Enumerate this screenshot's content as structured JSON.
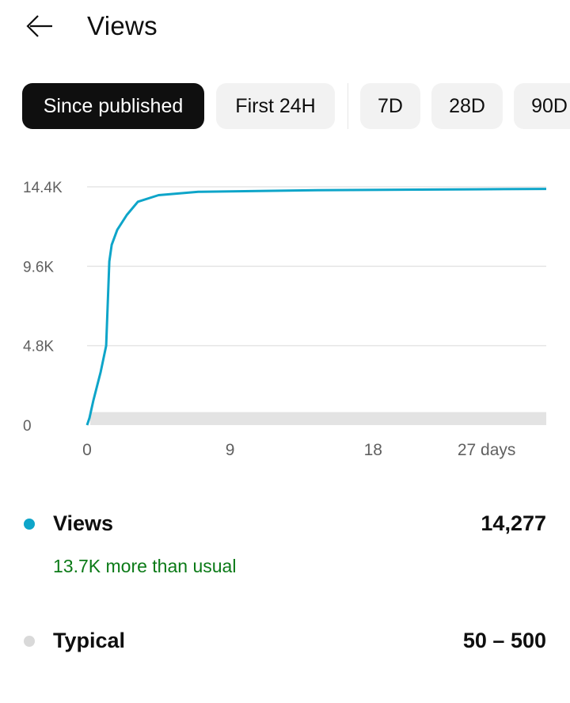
{
  "header": {
    "title": "Views",
    "back_icon": "arrow-left-icon"
  },
  "filters": {
    "chips": [
      {
        "label": "Since published",
        "active": true
      },
      {
        "label": "First 24H",
        "active": false
      },
      {
        "label": "7D",
        "active": false
      },
      {
        "label": "28D",
        "active": false
      },
      {
        "label": "90D",
        "active": false
      }
    ]
  },
  "colors": {
    "views": "#0ea5c9",
    "typical": "#d9d9d9",
    "positive": "#0b7a17",
    "active_chip": "#0f0f0f"
  },
  "chart_data": {
    "type": "line",
    "title": "",
    "xlabel": "",
    "ylabel": "",
    "x_ticks": [
      {
        "value": 0,
        "label": "0"
      },
      {
        "value": 9,
        "label": "9"
      },
      {
        "value": 18,
        "label": "18"
      },
      {
        "value": 27,
        "label": "27 days"
      }
    ],
    "y_ticks": [
      {
        "value": 0,
        "label": "0"
      },
      {
        "value": 4800,
        "label": "4.8K"
      },
      {
        "value": 9600,
        "label": "9.6K"
      },
      {
        "value": 14400,
        "label": "14.4K"
      }
    ],
    "xlim": [
      0,
      28.9
    ],
    "ylim": [
      0,
      14400
    ],
    "grid": true,
    "series": [
      {
        "name": "Views",
        "x": [
          0,
          0.15,
          0.4,
          0.85,
          1.2,
          1.4,
          1.55,
          1.9,
          2.5,
          3.2,
          4.5,
          7,
          14.5,
          24.5,
          28.9
        ],
        "values": [
          0,
          430,
          1500,
          3200,
          4800,
          9900,
          10900,
          11800,
          12700,
          13500,
          13900,
          14100,
          14200,
          14250,
          14277
        ]
      },
      {
        "name": "Typical",
        "band_low": 50,
        "band_high": 500
      }
    ]
  },
  "legend": {
    "views": {
      "label": "Views",
      "value": "14,277",
      "note": "13.7K more than usual"
    },
    "typical": {
      "label": "Typical",
      "value": "50 – 500"
    }
  }
}
